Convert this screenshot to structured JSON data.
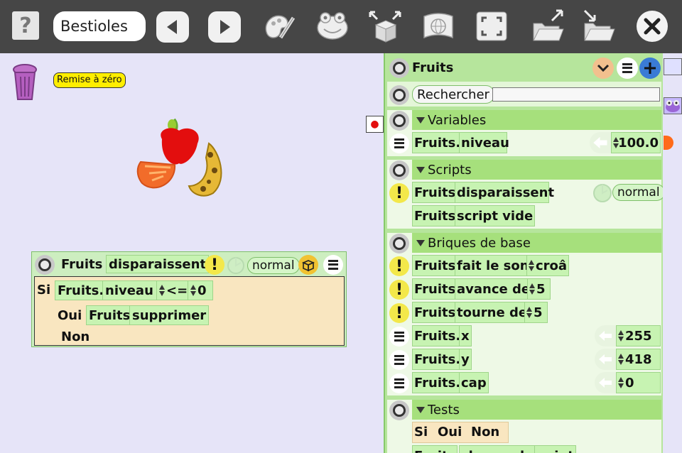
{
  "toolbar": {
    "help_label": "?",
    "project_name": "Bestioles",
    "icons": [
      "help-icon",
      "back-icon",
      "forward-icon",
      "paint-icon",
      "frog-icon",
      "box-expand-icon",
      "globe-icon",
      "fullscreen-icon",
      "folder-open-icon",
      "folder-save-icon",
      "close-icon"
    ]
  },
  "stage": {
    "reset_label": "Remise à zéro"
  },
  "script": {
    "title": "Fruits",
    "name": "disparaissent",
    "mode": "normal",
    "if_kw": "Si",
    "obj": "Fruits.",
    "var": "niveau",
    "op": "<=",
    "value": "0",
    "yes_kw": "Oui",
    "yes_obj": "Fruits",
    "yes_action": "supprimer",
    "no_kw": "Non"
  },
  "panel": {
    "title": "Fruits",
    "search_label": "Rechercher",
    "sections": {
      "variables": "Variables",
      "scripts": "Scripts",
      "base": "Briques de base",
      "tests": "Tests"
    },
    "var_row": {
      "obj": "Fruits.",
      "name": "niveau",
      "value": "100.0"
    },
    "script_row1": {
      "obj": "Fruits",
      "name": "disparaissent",
      "mode": "normal"
    },
    "script_row2": {
      "obj": "Fruits",
      "name": "script vide"
    },
    "base_rows": [
      {
        "obj": "Fruits",
        "action": "fait le son",
        "arg": "croâ"
      },
      {
        "obj": "Fruits",
        "action": "avance de",
        "arg": "5"
      },
      {
        "obj": "Fruits",
        "action": "tourne de",
        "arg": "5"
      }
    ],
    "attr_rows": [
      {
        "obj": "Fruits.",
        "name": "x",
        "value": "255"
      },
      {
        "obj": "Fruits.",
        "name": "y",
        "value": "418"
      },
      {
        "obj": "Fruits.",
        "name": "cap",
        "value": "0"
      }
    ],
    "tests_row": {
      "si": "Si",
      "oui": "Oui",
      "non": "Non"
    },
    "tests_row2": {
      "obj": "Fruits",
      "name": "chevauche",
      "arg": "point"
    }
  }
}
